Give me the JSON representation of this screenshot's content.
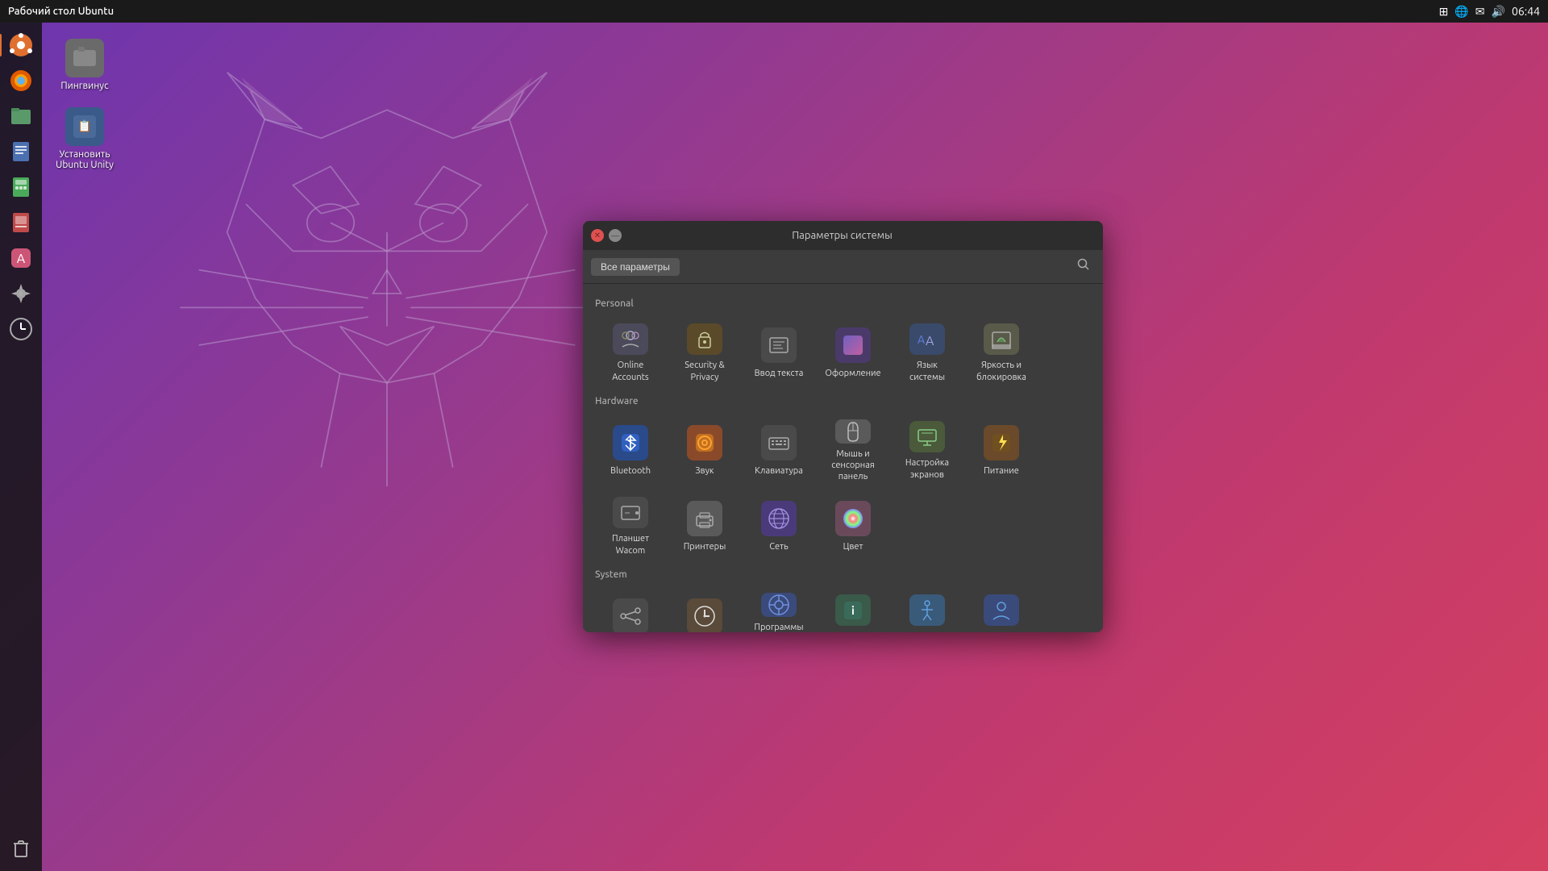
{
  "topbar": {
    "title": "Рабочий стол Ubuntu",
    "time": "06:44",
    "icons": [
      "network-icon",
      "globe-icon",
      "mail-icon",
      "volume-icon"
    ]
  },
  "desktop": {
    "icons": [
      {
        "id": "pingvinus",
        "label": "Пингвинус",
        "icon": "📁",
        "bg": "#6a6a6a"
      },
      {
        "id": "ubuntu-unity",
        "label": "Установить Ubuntu Unity",
        "icon": "📋",
        "bg": "#4a6a9a"
      }
    ]
  },
  "sidebar": {
    "items": [
      {
        "id": "ubuntu",
        "icon": "🐧",
        "label": "Ubuntu",
        "active": true
      },
      {
        "id": "firefox",
        "icon": "🦊",
        "label": "Firefox"
      },
      {
        "id": "files",
        "icon": "📁",
        "label": "Files"
      },
      {
        "id": "calc",
        "icon": "🧮",
        "label": "Calc"
      },
      {
        "id": "impress",
        "icon": "📊",
        "label": "Impress"
      },
      {
        "id": "appstore",
        "icon": "🛍",
        "label": "App Store"
      },
      {
        "id": "settings",
        "icon": "⚙",
        "label": "Settings"
      },
      {
        "id": "clock",
        "icon": "🕐",
        "label": "Clock"
      }
    ],
    "bottom": [
      {
        "id": "trash",
        "icon": "🗑",
        "label": "Trash"
      }
    ]
  },
  "settings_window": {
    "title": "Параметры системы",
    "toolbar": {
      "all_params_label": "Все параметры",
      "search_placeholder": "Поиск"
    },
    "sections": [
      {
        "id": "personal",
        "header": "Personal",
        "items": [
          {
            "id": "online-accounts",
            "label": "Online\nAccounts",
            "icon_type": "online-accounts"
          },
          {
            "id": "security-privacy",
            "label": "Security &\nPrivacy",
            "icon_type": "security"
          },
          {
            "id": "text-input",
            "label": "Ввод текста",
            "icon_type": "text-input"
          },
          {
            "id": "appearance",
            "label": "Оформление",
            "icon_type": "appearance"
          },
          {
            "id": "language",
            "label": "Язык\nсистемы",
            "icon_type": "language"
          },
          {
            "id": "brightness",
            "label": "Яркость и\nблокировка",
            "icon_type": "brightness"
          }
        ]
      },
      {
        "id": "hardware",
        "header": "Hardware",
        "items": [
          {
            "id": "bluetooth",
            "label": "Bluetooth",
            "icon_type": "bluetooth"
          },
          {
            "id": "sound",
            "label": "Звук",
            "icon_type": "sound"
          },
          {
            "id": "keyboard",
            "label": "Клавиатура",
            "icon_type": "keyboard"
          },
          {
            "id": "mouse",
            "label": "Мышь и\nсенсорная\nпанель",
            "icon_type": "mouse"
          },
          {
            "id": "displays",
            "label": "Настройка\nэкранов",
            "icon_type": "displays"
          },
          {
            "id": "power",
            "label": "Питание",
            "icon_type": "power"
          },
          {
            "id": "wacom",
            "label": "Планшет\nWacom",
            "icon_type": "wacom"
          },
          {
            "id": "printers",
            "label": "Принтеры",
            "icon_type": "printers"
          },
          {
            "id": "network",
            "label": "Сеть",
            "icon_type": "network"
          },
          {
            "id": "color",
            "label": "Цвет",
            "icon_type": "color"
          }
        ]
      },
      {
        "id": "system",
        "header": "System",
        "items": [
          {
            "id": "sharing",
            "label": "Sharing",
            "icon_type": "sharing"
          },
          {
            "id": "time",
            "label": "Время и дата",
            "icon_type": "time"
          },
          {
            "id": "software",
            "label": "Программы\nи\nобновления",
            "icon_type": "software"
          },
          {
            "id": "about",
            "label": "Сведения о\nсистеме",
            "icon_type": "about"
          },
          {
            "id": "accessibility",
            "label": "Специальные\nвозможности",
            "icon_type": "accessibility"
          },
          {
            "id": "accounts",
            "label": "Учётные\nзаписи",
            "icon_type": "accounts"
          }
        ]
      }
    ]
  }
}
